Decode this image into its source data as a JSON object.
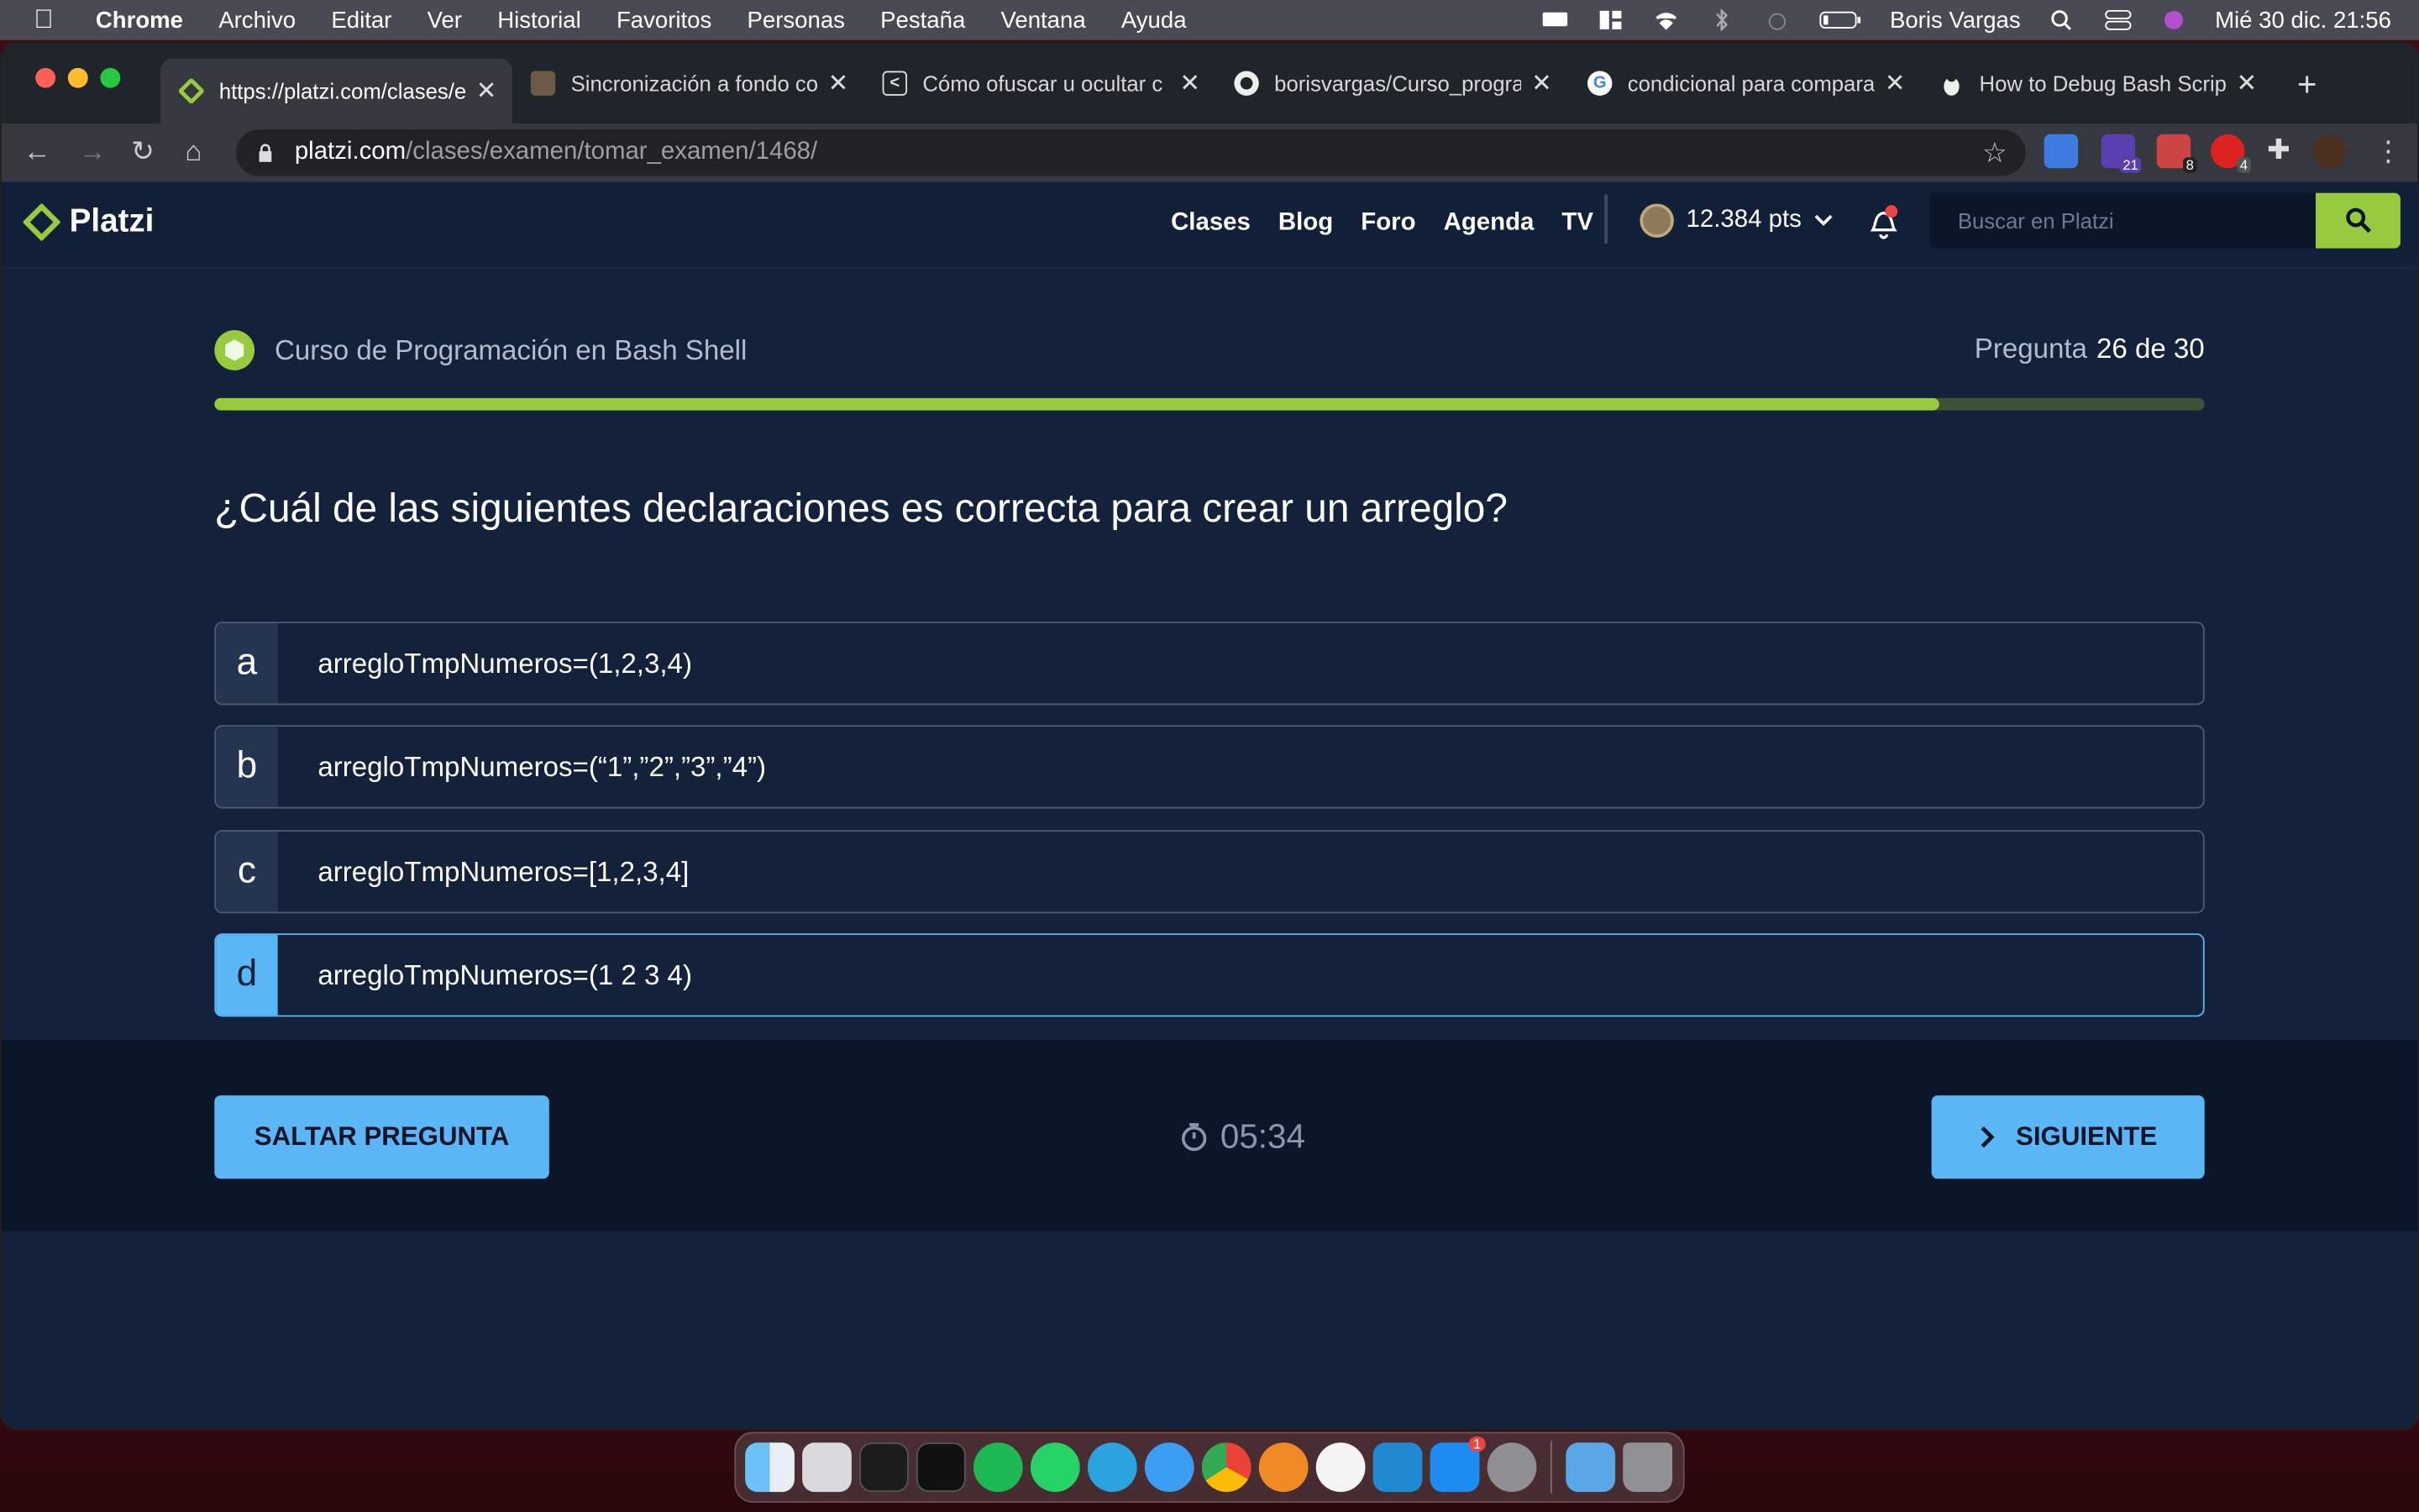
{
  "menubar": {
    "app_name": "Chrome",
    "items": [
      "Archivo",
      "Editar",
      "Ver",
      "Historial",
      "Favoritos",
      "Personas",
      "Pestaña",
      "Ventana",
      "Ayuda"
    ],
    "user": "Boris Vargas",
    "datetime": "Mié 30 dic.  21:56"
  },
  "tabs": [
    {
      "title": "https://platzi.com/clases/e",
      "favicon": "platzi-icon"
    },
    {
      "title": "Sincronización a fondo co",
      "favicon": "video-thumb-icon"
    },
    {
      "title": "Cómo ofuscar u ocultar c",
      "favicon": "share-icon"
    },
    {
      "title": "borisvargas/Curso_progra",
      "favicon": "github-icon"
    },
    {
      "title": "condicional para compara",
      "favicon": "google-icon"
    },
    {
      "title": "How to Debug Bash Scrip",
      "favicon": "linux-icon"
    }
  ],
  "address": {
    "domain": "platzi.com",
    "path": "/clases/examen/tomar_examen/1468/"
  },
  "extensions": {
    "badges": [
      "21",
      "8",
      "4"
    ]
  },
  "header": {
    "logo": "Platzi",
    "nav": [
      "Clases",
      "Blog",
      "Foro",
      "Agenda",
      "TV"
    ],
    "points": "12.384 pts",
    "search_placeholder": "Buscar en Platzi"
  },
  "exam": {
    "course": "Curso de Programación en Bash Shell",
    "question_label": "Pregunta",
    "question_count": "26 de 30",
    "progress": 0.8667,
    "question": "¿Cuál de las siguientes declaraciones es correcta para crear un arreglo?",
    "options": [
      {
        "letter": "a",
        "text": "arregloTmpNumeros=(1,2,3,4)",
        "selected": false
      },
      {
        "letter": "b",
        "text": "arregloTmpNumeros=(“1”,”2”,”3”,”4”)",
        "selected": false
      },
      {
        "letter": "c",
        "text": "arregloTmpNumeros=[1,2,3,4]",
        "selected": false
      },
      {
        "letter": "d",
        "text": "arregloTmpNumeros=(1 2 3 4)",
        "selected": true
      }
    ],
    "skip_label": "SALTAR PREGUNTA",
    "timer": "05:34",
    "next_label": "SIGUIENTE"
  },
  "dock": {
    "apps": [
      "finder-icon",
      "launchpad-icon",
      "terminal-icon",
      "iterm-icon",
      "spotify-icon",
      "whatsapp-icon",
      "telegram-icon",
      "safari-icon",
      "chrome-icon",
      "sketch-icon",
      "textedit-icon",
      "vscode-icon",
      "appstore-icon",
      "settings-icon",
      "downloads-folder-icon",
      "trash-icon"
    ],
    "appstore_badge": "1"
  },
  "colors": {
    "accent_green": "#98ca3f",
    "accent_blue": "#5bb6f6",
    "page_bg": "#13213b"
  }
}
